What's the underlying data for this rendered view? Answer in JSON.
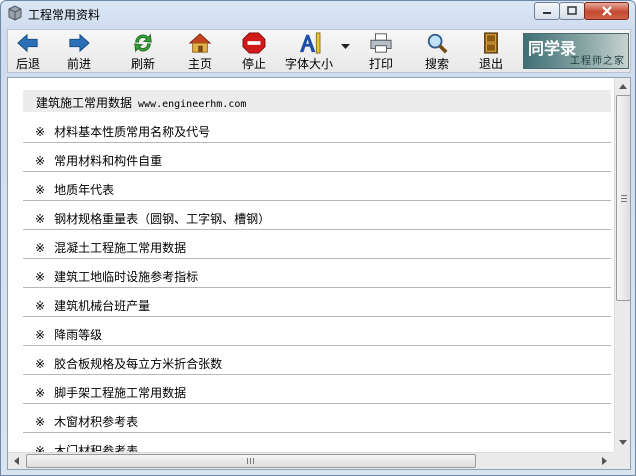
{
  "window": {
    "title": "工程常用资料"
  },
  "toolbar": {
    "buttons": [
      {
        "label": "后退",
        "icon": "back-arrow-icon"
      },
      {
        "label": "前进",
        "icon": "forward-arrow-icon"
      },
      {
        "label": "刷新",
        "icon": "refresh-icon"
      },
      {
        "label": "主页",
        "icon": "home-icon"
      },
      {
        "label": "停止",
        "icon": "stop-icon"
      },
      {
        "label": "字体大小",
        "icon": "font-size-icon"
      },
      {
        "label": "打印",
        "icon": "printer-icon"
      },
      {
        "label": "搜索",
        "icon": "search-icon"
      },
      {
        "label": "退出",
        "icon": "exit-door-icon"
      }
    ],
    "banner": {
      "main": "同学录",
      "sub": "工程师之家"
    }
  },
  "content": {
    "header": {
      "title": "建筑施工常用数据",
      "url": "www.engineerhm.com"
    },
    "mark": "※",
    "items": [
      "材料基本性质常用名称及代号",
      "常用材料和构件自重",
      "地质年代表",
      "钢材规格重量表（圆钢、工字钢、槽钢）",
      "混凝土工程施工常用数据",
      "建筑工地临时设施参考指标",
      "建筑机械台班产量",
      "降雨等级",
      "胶合板规格及每立方米折合张数",
      "脚手架工程施工常用数据",
      "木窗材积参考表",
      "木门材积参考表"
    ]
  },
  "colors": {
    "title_bg": "#cfdcee",
    "close_button": "#c44a32",
    "banner": "#3f6f76",
    "row_divider": "#b7b7b7"
  }
}
